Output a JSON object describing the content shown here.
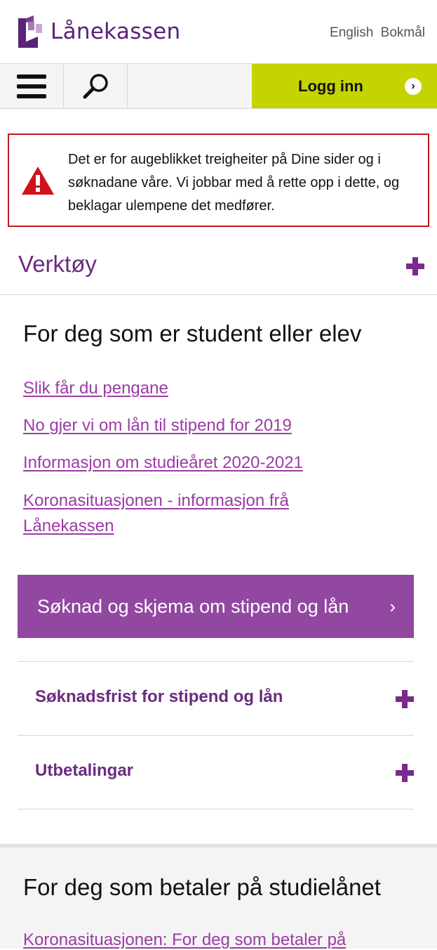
{
  "header": {
    "brand": "Lånekassen",
    "lang_english": "English",
    "lang_bokmal": "Bokmål"
  },
  "navbar": {
    "menu_icon": "hamburger-icon",
    "search_icon": "search-icon",
    "login_label": "Logg inn",
    "login_chevron": "›"
  },
  "alert": {
    "icon": "warning-icon",
    "text": "Det er for augeblikket treigheiter på Dine sider og i søknadane våre. Vi jobbar med å rette opp i dette, og beklagar ulempene det medfører."
  },
  "tools": {
    "title": "Verktøy"
  },
  "student": {
    "title": "For deg som er student eller elev",
    "links": [
      "Slik får du pengane",
      "No gjer vi om lån til stipend for 2019",
      "Informasjon om studieåret 2020-2021",
      "Koronasituasjonen - informasjon frå Lånekassen"
    ],
    "cta_label": "Søknad og skjema om stipend og lån",
    "cta_chevron": "›",
    "accordions": [
      "Søknadsfrist for stipend og lån",
      "Utbetalingar"
    ]
  },
  "payer": {
    "title": "For deg som betaler på studielånet",
    "link": "Koronasituasjonen: For deg som betaler på"
  },
  "colors": {
    "brand_purple": "#5a2278",
    "link_purple": "#9c3ba6",
    "cta_purple": "#9247a0",
    "login_green": "#c5d300",
    "alert_red": "#c4141c"
  }
}
